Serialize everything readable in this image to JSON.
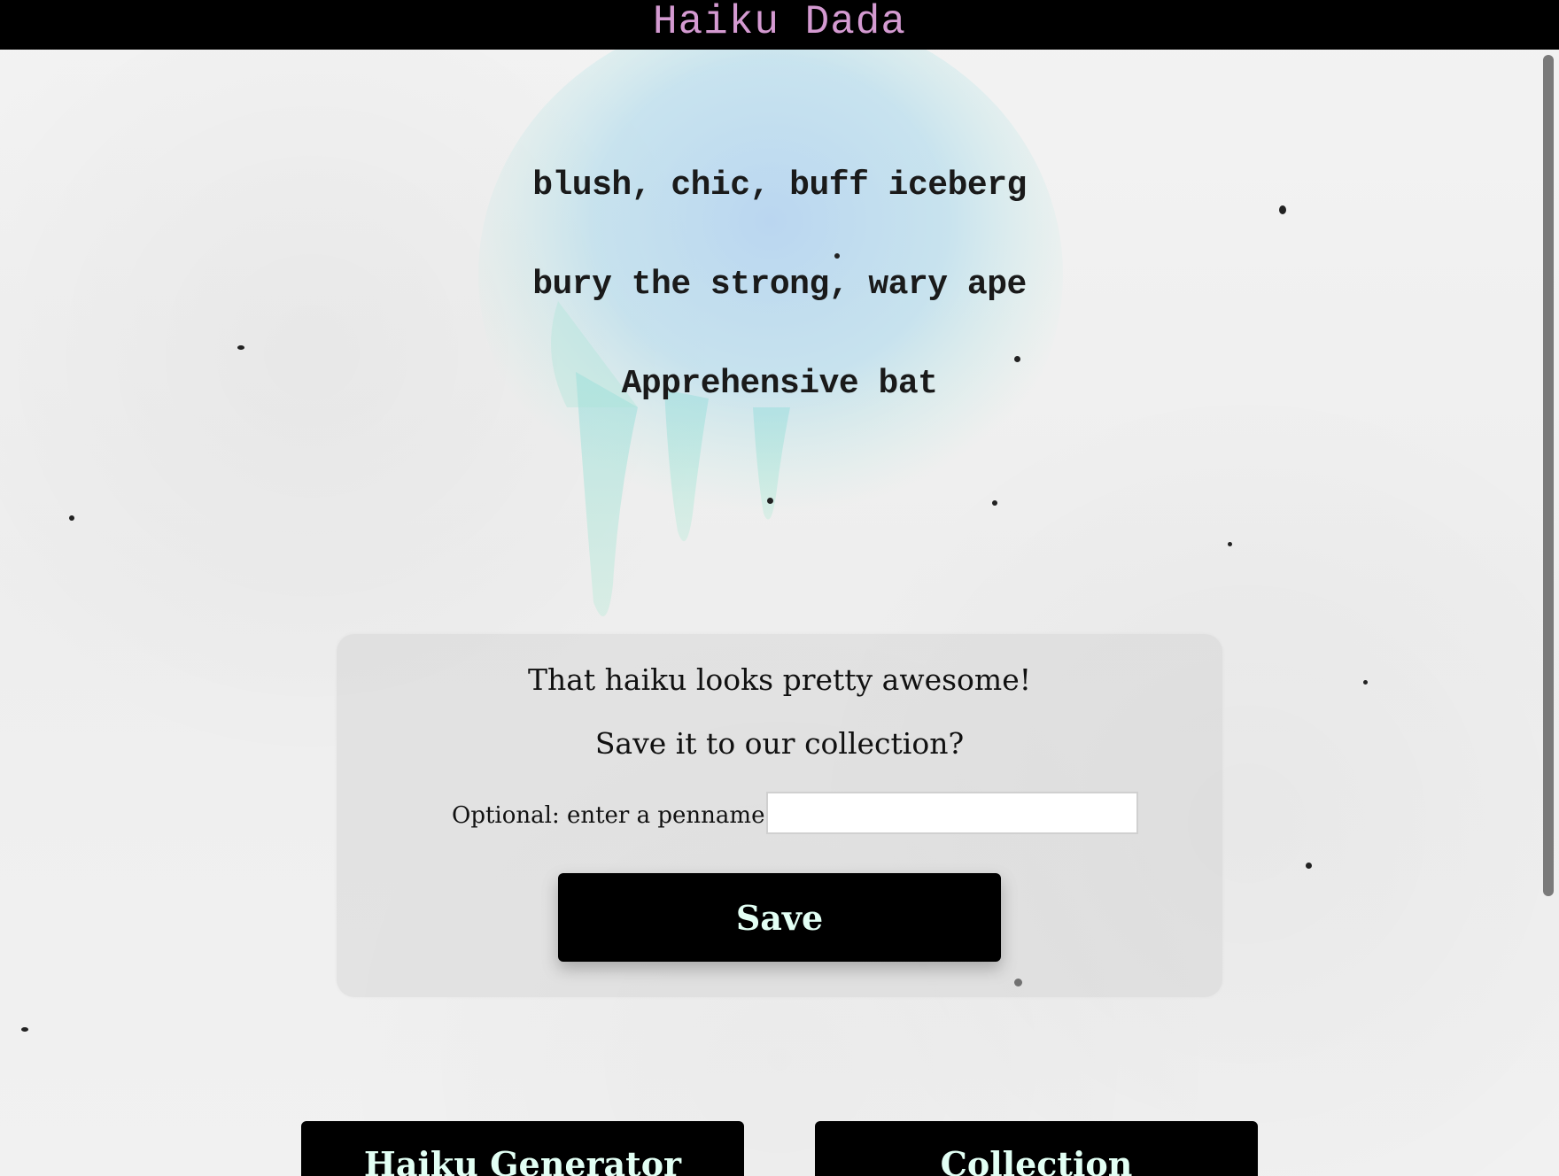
{
  "header": {
    "title": "Haiku Dada"
  },
  "haiku": {
    "lines": [
      "blush, chic, buff iceberg",
      "bury the strong, wary ape",
      "Apprehensive bat"
    ]
  },
  "save_panel": {
    "line1": "That haiku looks pretty awesome!",
    "line2": "Save it to our collection?",
    "penname_label": "Optional: enter a penname",
    "penname_value": "",
    "save_label": "Save"
  },
  "nav": {
    "generator_label": "Haiku Generator",
    "collection_label": "Collection"
  },
  "colors": {
    "header_bg": "#000000",
    "title": "#d49ad1",
    "button_bg": "#000000",
    "button_text": "#e2fff4",
    "splash": "#a9d8ee"
  }
}
